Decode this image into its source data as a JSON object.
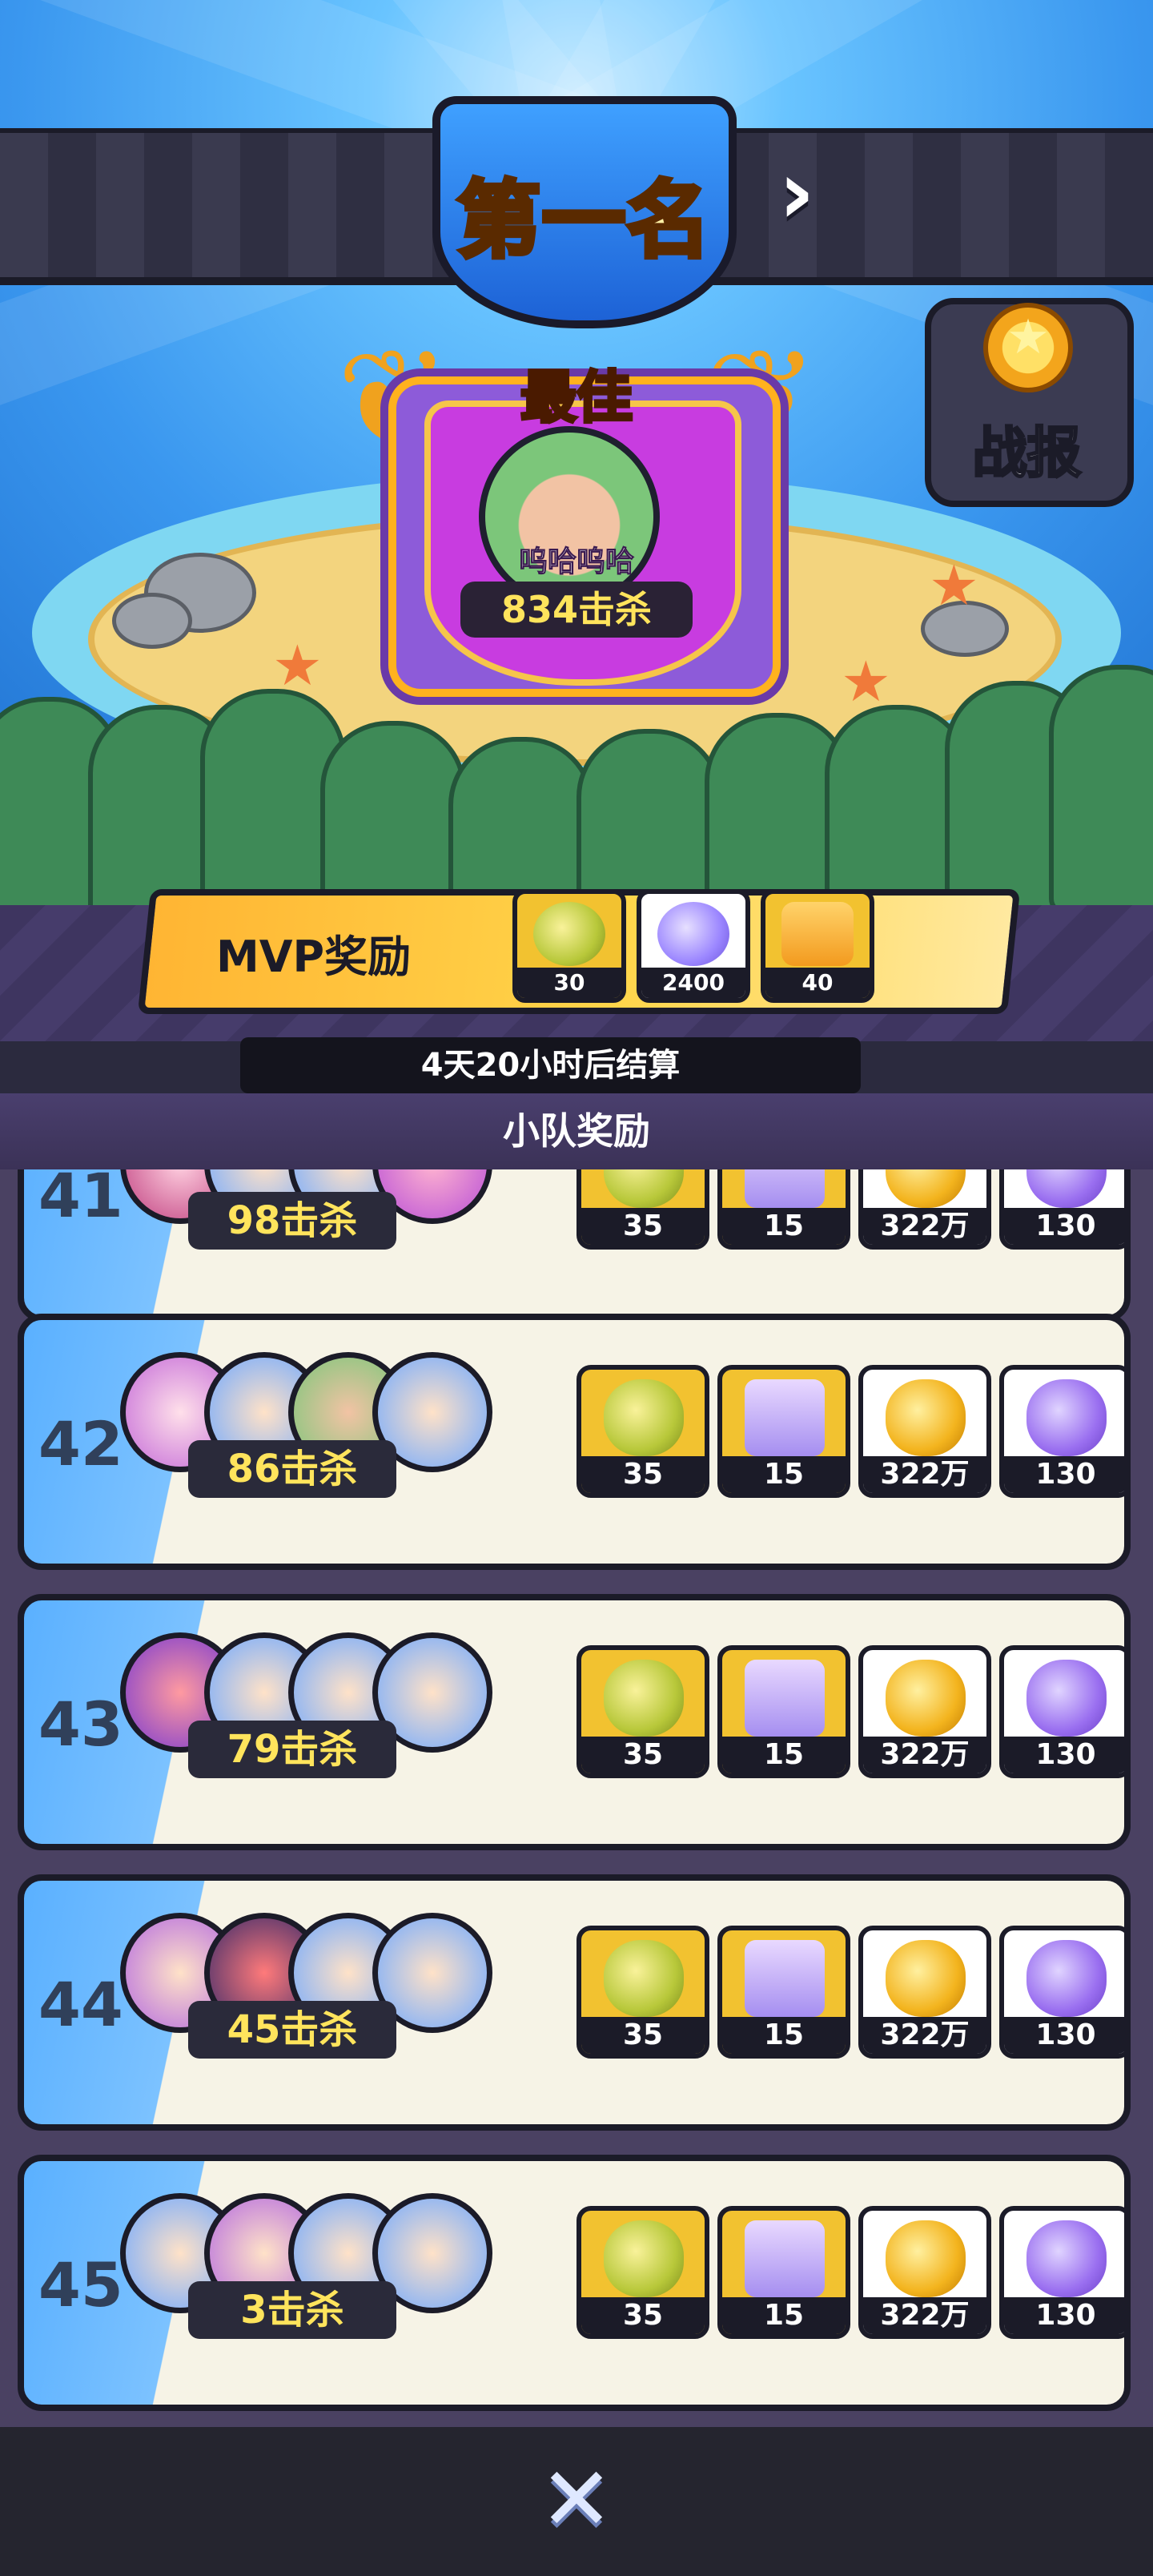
{
  "header": {
    "rank_title": "第一名",
    "next_icon": "chevron-right-icon"
  },
  "mvp": {
    "best_label": "最佳",
    "player_name": "呜哈呜哈",
    "kills": "834击杀"
  },
  "report_button": {
    "label": "战报",
    "icon": "star-medal-icon"
  },
  "mvp_reward": {
    "label": "MVP奖励",
    "items": [
      {
        "icon": "golden-fruit-icon",
        "qty": "30",
        "color": "#f2c230"
      },
      {
        "icon": "orb-pair-icon",
        "qty": "2400",
        "color": "#ffffff"
      },
      {
        "icon": "ticket-icon",
        "qty": "40",
        "color": "#f2c230"
      }
    ]
  },
  "settlement_text": "4天20小时后结算",
  "squad_reward_title": "小队奖励",
  "rows": [
    {
      "rank": "41",
      "kills": "98击杀"
    },
    {
      "rank": "42",
      "kills": "86击杀"
    },
    {
      "rank": "43",
      "kills": "79击杀"
    },
    {
      "rank": "44",
      "kills": "45击杀"
    },
    {
      "rank": "45",
      "kills": "3击杀"
    }
  ],
  "row_rewards": [
    {
      "icon": "golden-fruit-icon",
      "qty": "35"
    },
    {
      "icon": "mystery-box-icon",
      "qty": "15"
    },
    {
      "icon": "gold-candy-icon",
      "qty": "322万"
    },
    {
      "icon": "purple-capsule-icon",
      "qty": "130"
    }
  ],
  "close_icon": "close-icon",
  "colors": {
    "gold": "#f2c230",
    "dark": "#1b1b28",
    "kill_text": "#ffe45c",
    "row_blue": "#5ab0ff"
  }
}
